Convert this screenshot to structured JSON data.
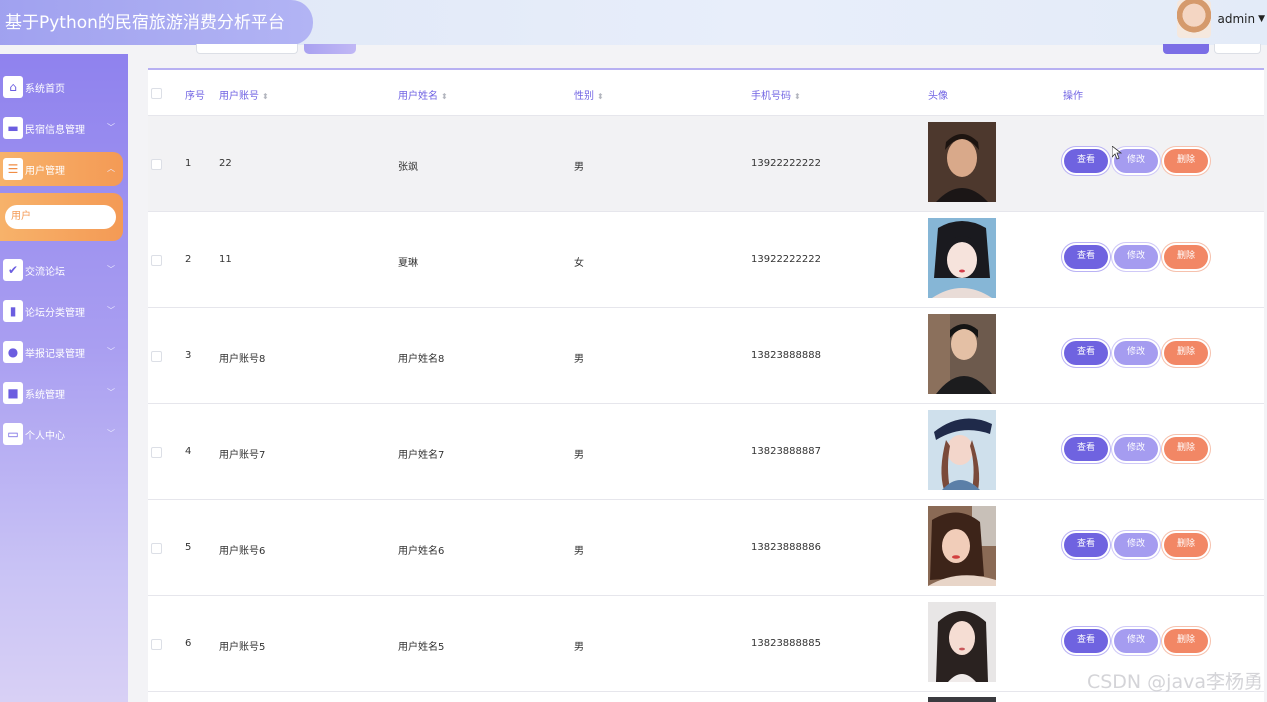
{
  "app": {
    "title": "基于Python的民宿旅游消费分析平台",
    "user_name": "admin",
    "accent_color": "#7164e3",
    "sidebar_active_color": "#f49a55"
  },
  "sidebar": {
    "items": [
      {
        "label": "系统首页",
        "icon": "home-icon"
      },
      {
        "label": "民宿信息管理",
        "icon": "monitor-icon"
      },
      {
        "label": "用户管理",
        "icon": "sliders-icon",
        "active": true
      },
      {
        "label": "交流论坛",
        "icon": "clipboard-icon"
      },
      {
        "label": "论坛分类管理",
        "icon": "book-icon"
      },
      {
        "label": "举报记录管理",
        "icon": "balloon-icon"
      },
      {
        "label": "系统管理",
        "icon": "briefcase-icon"
      },
      {
        "label": "个人中心",
        "icon": "window-icon"
      }
    ],
    "submenu": {
      "label": "用户"
    }
  },
  "table": {
    "headers": {
      "index": "序号",
      "account": "用户账号",
      "name": "用户姓名",
      "gender": "性别",
      "phone": "手机号码",
      "avatar": "头像",
      "actions": "操作"
    },
    "rows": [
      {
        "index": "1",
        "account": "22",
        "name": "张飒",
        "gender": "男",
        "phone": "13922222222"
      },
      {
        "index": "2",
        "account": "11",
        "name": "夏琳",
        "gender": "女",
        "phone": "13922222222"
      },
      {
        "index": "3",
        "account": "用户账号8",
        "name": "用户姓名8",
        "gender": "男",
        "phone": "13823888888"
      },
      {
        "index": "4",
        "account": "用户账号7",
        "name": "用户姓名7",
        "gender": "男",
        "phone": "13823888887"
      },
      {
        "index": "5",
        "account": "用户账号6",
        "name": "用户姓名6",
        "gender": "男",
        "phone": "13823888886"
      },
      {
        "index": "6",
        "account": "用户账号5",
        "name": "用户姓名5",
        "gender": "男",
        "phone": "13823888885"
      }
    ],
    "actions": {
      "view": "查看",
      "edit": "修改",
      "delete": "删除"
    }
  },
  "watermark": "CSDN @java李杨勇"
}
